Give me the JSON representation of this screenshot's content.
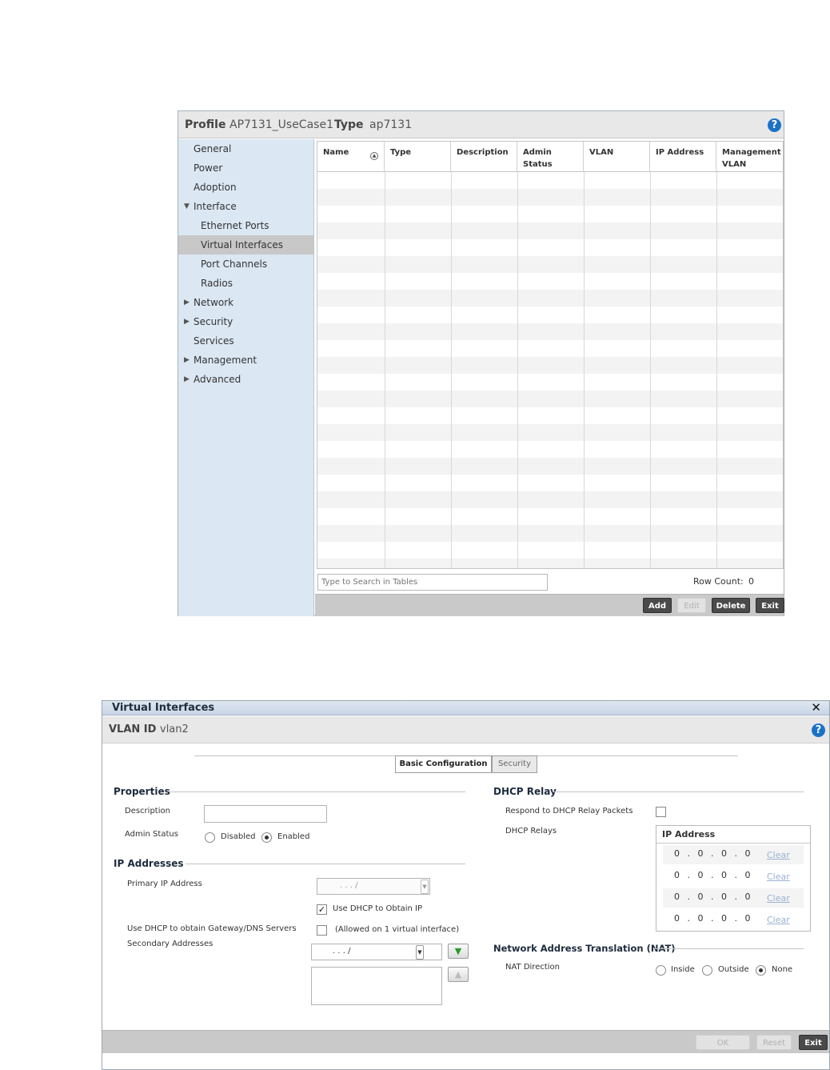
{
  "panel1": {
    "profile_label": "Profile",
    "profile_value": "AP7131_UseCase1",
    "type_label": "Type",
    "type_value": "ap7131",
    "help_icon": "?",
    "nav": [
      {
        "label": "General",
        "arrow": "",
        "indent": false,
        "selected": false
      },
      {
        "label": "Power",
        "arrow": "",
        "indent": false,
        "selected": false
      },
      {
        "label": "Adoption",
        "arrow": "",
        "indent": false,
        "selected": false
      },
      {
        "label": "Interface",
        "arrow": "▼",
        "indent": false,
        "selected": false
      },
      {
        "label": "Ethernet Ports",
        "arrow": "",
        "indent": true,
        "selected": false
      },
      {
        "label": "Virtual Interfaces",
        "arrow": "",
        "indent": true,
        "selected": true
      },
      {
        "label": "Port Channels",
        "arrow": "",
        "indent": true,
        "selected": false
      },
      {
        "label": "Radios",
        "arrow": "",
        "indent": true,
        "selected": false
      },
      {
        "label": "Network",
        "arrow": "▶",
        "indent": false,
        "selected": false
      },
      {
        "label": "Security",
        "arrow": "▶",
        "indent": false,
        "selected": false
      },
      {
        "label": "Services",
        "arrow": "",
        "indent": false,
        "selected": false
      },
      {
        "label": "Management",
        "arrow": "▶",
        "indent": false,
        "selected": false
      },
      {
        "label": "Advanced",
        "arrow": "▶",
        "indent": false,
        "selected": false
      }
    ],
    "columns": [
      "Name",
      "Type",
      "Description",
      "Admin Status",
      "VLAN",
      "IP Address",
      "Management VLAN"
    ],
    "search_placeholder": "Type to Search in Tables",
    "row_count_label": "Row Count:",
    "row_count_value": "0",
    "buttons": {
      "add": "Add",
      "edit": "Edit",
      "delete": "Delete",
      "exit": "Exit"
    }
  },
  "panel2": {
    "window_title": "Virtual Interfaces",
    "close_icon": "✕",
    "vlan_label": "VLAN ID",
    "vlan_value": "vlan2",
    "help_icon": "?",
    "tabs": [
      "Basic Configuration",
      "Security"
    ],
    "properties": {
      "section": "Properties",
      "description_label": "Description",
      "description_value": "",
      "admin_status_label": "Admin Status",
      "admin_options": [
        "Disabled",
        "Enabled"
      ],
      "admin_selected": "Enabled"
    },
    "ip": {
      "section": "IP Addresses",
      "primary_label": "Primary IP Address",
      "primary_value": ".   .   .   /",
      "use_dhcp_label": "Use DHCP to Obtain IP",
      "use_dhcp_checked": true,
      "gateway_label": "Use DHCP to obtain Gateway/DNS Servers",
      "gateway_note": "(Allowed on 1 virtual interface)",
      "gateway_checked": false,
      "secondary_label": "Secondary Addresses",
      "secondary_value": ".   .   .   /"
    },
    "dhcp_relay": {
      "section": "DHCP Relay",
      "respond_label": "Respond to DHCP Relay Packets",
      "respond_checked": false,
      "relays_label": "DHCP Relays",
      "table_header": "IP Address",
      "rows": [
        {
          "ip": "0 . 0 . 0 . 0",
          "action": "Clear"
        },
        {
          "ip": "0 . 0 . 0 . 0",
          "action": "Clear"
        },
        {
          "ip": "0 . 0 . 0 . 0",
          "action": "Clear"
        },
        {
          "ip": "0 . 0 . 0 . 0",
          "action": "Clear"
        }
      ]
    },
    "nat": {
      "section": "Network Address Translation (NAT)",
      "direction_label": "NAT Direction",
      "options": [
        "Inside",
        "Outside",
        "None"
      ],
      "selected": "None"
    },
    "buttons": {
      "ok": "OK",
      "reset": "Reset",
      "exit": "Exit"
    }
  }
}
